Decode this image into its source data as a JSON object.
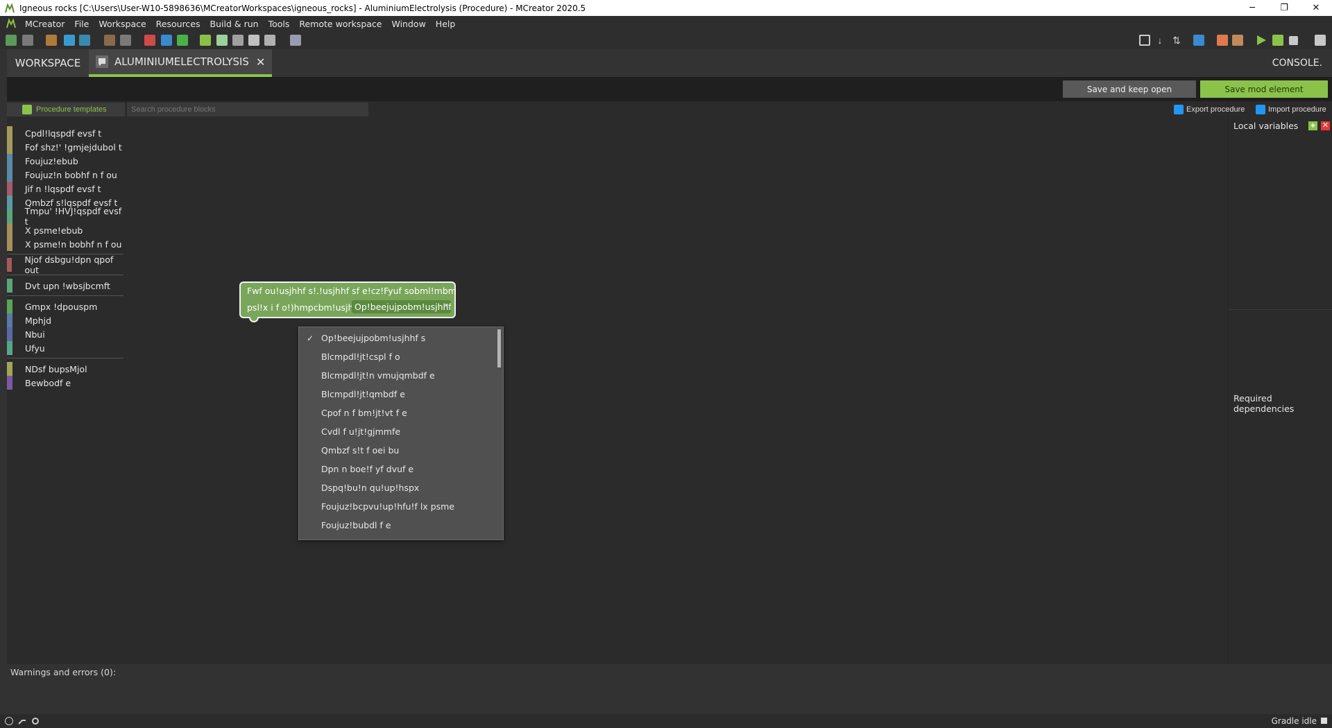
{
  "window": {
    "title": "Igneous rocks [C:\\Users\\User-W10-5898636\\MCreatorWorkspaces\\igneous_rocks] - AluminiumElectrolysis (Procedure) - MCreator 2020.5",
    "minimize": "─",
    "maximize": "❐",
    "close": "✕"
  },
  "menu": {
    "items": [
      "MCreator",
      "File",
      "Workspace",
      "Resources",
      "Build & run",
      "Tools",
      "Remote workspace",
      "Window",
      "Help"
    ]
  },
  "tabs": {
    "workspace": "WORKSPACE",
    "active": "ALUMINIUMELECTROLYSIS",
    "close": "✕",
    "console": "CONSOLE."
  },
  "actions": {
    "save_keep": "Save and keep open",
    "save_mod": "Save mod element"
  },
  "editor": {
    "templates_label": "Procedure templates",
    "search_placeholder": "Search procedure blocks",
    "export_label": "Export procedure",
    "import_label": "Import procedure"
  },
  "palette": {
    "groups": [
      [
        {
          "label": "Cpdl!lqspdf evsf t",
          "color": "#a49a5a"
        },
        {
          "label": "Fof shz!' !gmjejdubol t",
          "color": "#a59a5c"
        },
        {
          "label": "Foujuz!ebub",
          "color": "#5a8aa5"
        },
        {
          "label": "Foujuz!n bobhf n f ou",
          "color": "#5a8aa5"
        },
        {
          "label": "Jif n !lqspdf evsf t",
          "color": "#a55a6a"
        },
        {
          "label": "Qmbzf s!lqspdf evsf t",
          "color": "#5a9aa5"
        },
        {
          "label": "Tmpu' !HVJ!qspdf evsf t",
          "color": "#5aa57a"
        },
        {
          "label": "X psme!ebub",
          "color": "#a5905a"
        },
        {
          "label": "X psme!n bobhf n f ou",
          "color": "#a5905a"
        }
      ],
      [
        {
          "label": "Njof dsbgu!dpn qpof out",
          "color": "#a55a5a"
        }
      ],
      [
        {
          "label": "Dvt upn !wbsjbcmft",
          "color": "#5aa57a"
        }
      ],
      [
        {
          "label": "Gmpx !dpouspm",
          "color": "#5aa55a"
        },
        {
          "label": "Mphjd",
          "color": "#5a7aa5"
        },
        {
          "label": "Nbui",
          "color": "#5a6aa5"
        },
        {
          "label": "Ufyu",
          "color": "#5aa58a"
        }
      ],
      [
        {
          "label": "NDsf bupsMjol",
          "color": "#a5a55a"
        },
        {
          "label": "Bewbodf e",
          "color": "#7a5aa5"
        }
      ]
    ]
  },
  "block": {
    "line1": "Fwf ou!usjhhf s!.!usjhhf sf e!cz!Fyuf sobml!mbm",
    "line2": "psl!x i f o!)hmpcbm!usjhhf s*;",
    "field": "Op!beejujpobm!usjhhf s",
    "field_arrow": "▾"
  },
  "dropdown": {
    "selected_mark": "✓",
    "items": [
      "Op!beejujpobm!usjhhf s",
      "Blcmpdl!jt!cspl f o",
      "Blcmpdl!jt!n vmujqmbdf e",
      "Blcmpdl!jt!qmbdf e",
      "Cpof n f bm!jt!vt f e",
      "Cvdl f u!jt!gjmmfe",
      "Qmbzf s!t f oei bu",
      "Dpn n boe!f yf dvuf e",
      "Dspq!bu!n qu!up!hspx",
      "Foujuz!bcpvu!up!hfu!f lx psme",
      "Foujuz!bubdl f e"
    ]
  },
  "right_panel": {
    "local_vars": "Local variables",
    "add": "+",
    "remove": "✕",
    "required_deps": "Required dependencies"
  },
  "bottom": {
    "warnings": "Warnings and errors (0):",
    "gradle": "Gradle idle"
  },
  "colors": {
    "accent": "#8bc34a",
    "block": "#79a65b",
    "background": "#2b2b2b"
  }
}
